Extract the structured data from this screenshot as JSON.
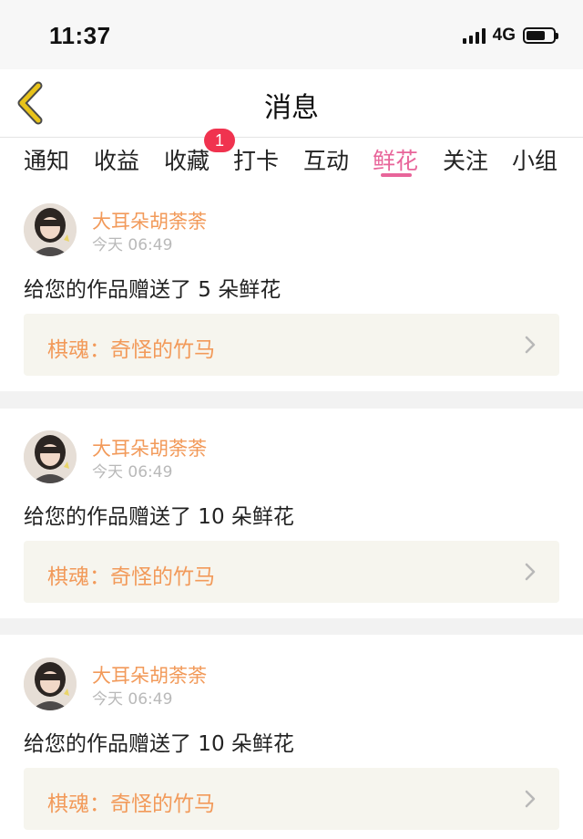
{
  "status_bar": {
    "time": "11:37",
    "network": "4G"
  },
  "nav": {
    "title": "消息",
    "back_icon": "chevron-left-icon",
    "accent_color": "#e8c31a"
  },
  "tabs": [
    {
      "label": "通知",
      "active": false
    },
    {
      "label": "收益",
      "active": false
    },
    {
      "label": "收藏",
      "active": false,
      "badge": "1"
    },
    {
      "label": "打卡",
      "active": false
    },
    {
      "label": "互动",
      "active": false
    },
    {
      "label": "鲜花",
      "active": true
    },
    {
      "label": "关注",
      "active": false
    },
    {
      "label": "小组",
      "active": false
    }
  ],
  "colors": {
    "active_tab": "#e8659a",
    "badge": "#f0334f",
    "sender": "#f29a5a",
    "link_bg": "#f6f5ee"
  },
  "messages": [
    {
      "sender": "大耳朵胡荼荼",
      "time": "今天 06:49",
      "text": "给您的作品赠送了 5 朵鲜花",
      "work_title": "棋魂：奇怪的竹马"
    },
    {
      "sender": "大耳朵胡荼荼",
      "time": "今天 06:49",
      "text": "给您的作品赠送了 10 朵鲜花",
      "work_title": "棋魂：奇怪的竹马"
    },
    {
      "sender": "大耳朵胡荼荼",
      "time": "今天 06:49",
      "text": "给您的作品赠送了 10 朵鲜花",
      "work_title": "棋魂：奇怪的竹马"
    }
  ]
}
